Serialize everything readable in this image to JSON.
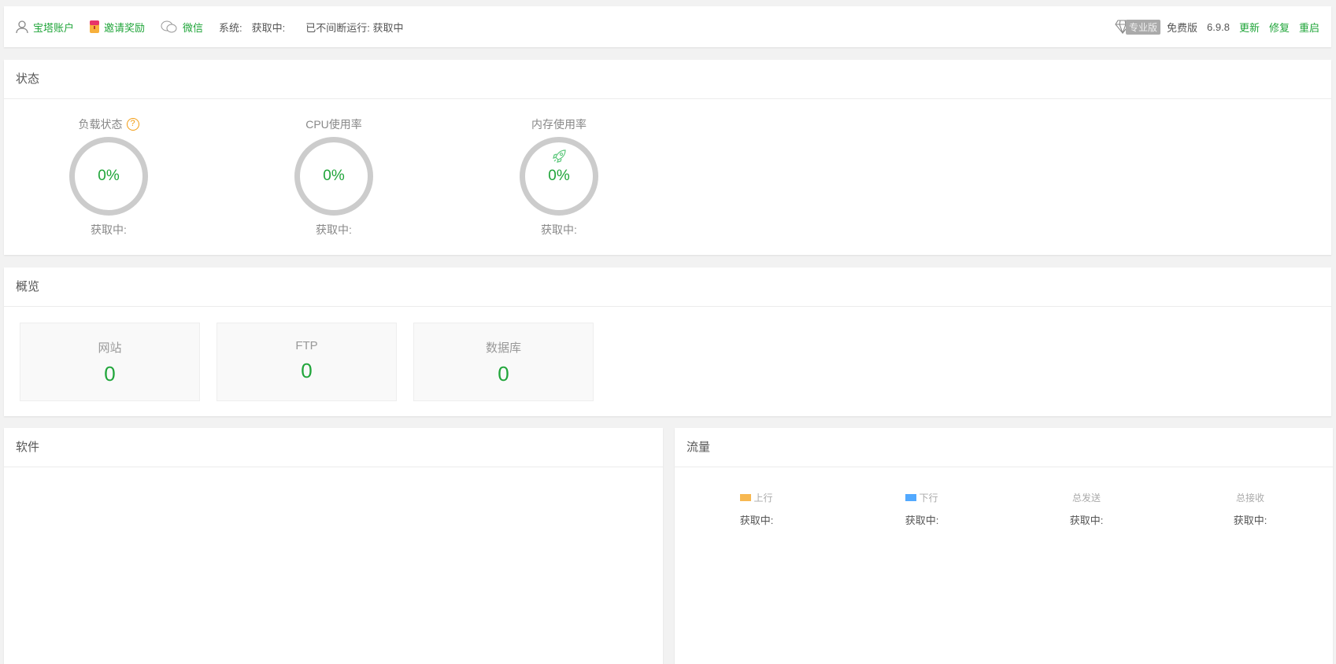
{
  "topbar": {
    "account": "宝塔账户",
    "invite": "邀请奖励",
    "wechat": "微信",
    "system_label": "系统:",
    "system_value": "获取中:",
    "uptime": "已不间断运行: 获取中",
    "pro_badge": "专业版",
    "edition": "免费版",
    "version": "6.9.8",
    "update": "更新",
    "repair": "修复",
    "restart": "重启"
  },
  "status": {
    "title": "状态",
    "gauges": [
      {
        "label": "负载状态",
        "value": "0%",
        "sub": "获取中:"
      },
      {
        "label": "CPU使用率",
        "value": "0%",
        "sub": "获取中:"
      },
      {
        "label": "内存使用率",
        "value": "0%",
        "sub": "获取中:"
      }
    ]
  },
  "overview": {
    "title": "概览",
    "cards": [
      {
        "label": "网站",
        "value": "0"
      },
      {
        "label": "FTP",
        "value": "0"
      },
      {
        "label": "数据库",
        "value": "0"
      }
    ]
  },
  "software": {
    "title": "软件"
  },
  "traffic": {
    "title": "流量",
    "items": [
      {
        "label": "上行",
        "value": "获取中:",
        "color": "#f7b851"
      },
      {
        "label": "下行",
        "value": "获取中:",
        "color": "#52a9ff"
      },
      {
        "label": "总发送",
        "value": "获取中:"
      },
      {
        "label": "总接收",
        "value": "获取中:"
      }
    ]
  }
}
